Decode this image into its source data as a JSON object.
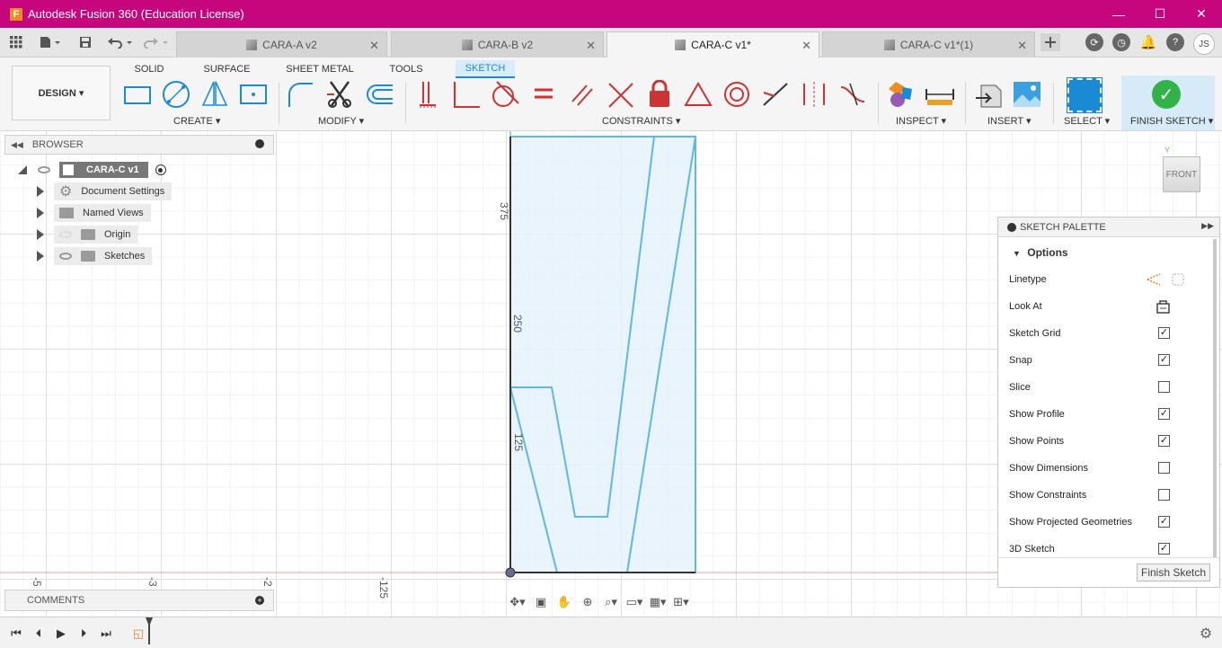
{
  "window": {
    "title": "Autodesk Fusion 360 (Education License)",
    "logo_letter": "F",
    "minimize": "—",
    "maximize": "☐",
    "close": "✕"
  },
  "tabs": [
    {
      "label": "CARA-A v2",
      "active": false
    },
    {
      "label": "CARA-B v2",
      "active": false
    },
    {
      "label": "CARA-C v1*",
      "active": true
    },
    {
      "label": "CARA-C v1*(1)",
      "active": false
    }
  ],
  "user_initials": "JS",
  "ribbon": {
    "workspace": "DESIGN ▾",
    "tabs": [
      "SOLID",
      "SURFACE",
      "SHEET METAL",
      "TOOLS",
      "SKETCH"
    ],
    "groups": {
      "create": "CREATE ▾",
      "modify": "MODIFY ▾",
      "constraints": "CONSTRAINTS ▾",
      "inspect": "INSPECT ▾",
      "insert": "INSERT ▾",
      "select": "SELECT ▾",
      "finish": "FINISH SKETCH ▾"
    }
  },
  "browser": {
    "title": "BROWSER",
    "root": "CARA-C v1",
    "items": [
      "Document Settings",
      "Named Views",
      "Origin",
      "Sketches"
    ]
  },
  "palette": {
    "title": "SKETCH PALETTE",
    "section": "Options",
    "options": [
      {
        "label": "Linetype",
        "checked": null
      },
      {
        "label": "Look At",
        "checked": null
      },
      {
        "label": "Sketch Grid",
        "checked": true
      },
      {
        "label": "Snap",
        "checked": true
      },
      {
        "label": "Slice",
        "checked": false
      },
      {
        "label": "Show Profile",
        "checked": true
      },
      {
        "label": "Show Points",
        "checked": true
      },
      {
        "label": "Show Dimensions",
        "checked": false
      },
      {
        "label": "Show Constraints",
        "checked": false
      },
      {
        "label": "Show Projected Geometries",
        "checked": true
      },
      {
        "label": "3D Sketch",
        "checked": true
      }
    ],
    "finish_button": "Finish Sketch"
  },
  "canvas": {
    "ruler_vertical": [
      "375",
      "250",
      "125"
    ],
    "ruler_horizontal": [
      "-5",
      "-3",
      "-2",
      "-125"
    ],
    "viewcube_face": "FRONT",
    "axis_y_label": "Y"
  },
  "comments": {
    "title": "COMMENTS"
  },
  "colors": {
    "titlebar": "#c5067c",
    "accent": "#1a8ad4",
    "sketch_line": "#5eb8e0",
    "profile_fill": "#e3f1fb",
    "finish_green": "#31b349"
  }
}
